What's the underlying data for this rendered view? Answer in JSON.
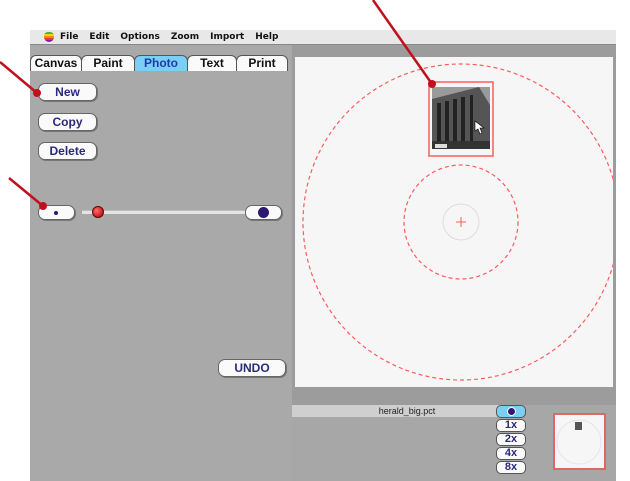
{
  "menubar": {
    "items": [
      "File",
      "Edit",
      "Options",
      "Zoom",
      "Import",
      "Help"
    ]
  },
  "tabs": [
    {
      "label": "Canvas",
      "active": false
    },
    {
      "label": "Paint",
      "active": false
    },
    {
      "label": "Photo",
      "active": true
    },
    {
      "label": "Text",
      "active": false
    },
    {
      "label": "Print",
      "active": false
    }
  ],
  "buttons": {
    "new": "New",
    "copy": "Copy",
    "delete": "Delete",
    "undo": "UNDO"
  },
  "file_name": "herald_big.pct",
  "zoom_levels": [
    "1x",
    "2x",
    "4x",
    "8x"
  ],
  "colors": {
    "accent_tab": "#7ad0f4",
    "guide_red": "#ff5b5b",
    "arrow": "#c0101e",
    "button_text": "#2a2a7a"
  }
}
